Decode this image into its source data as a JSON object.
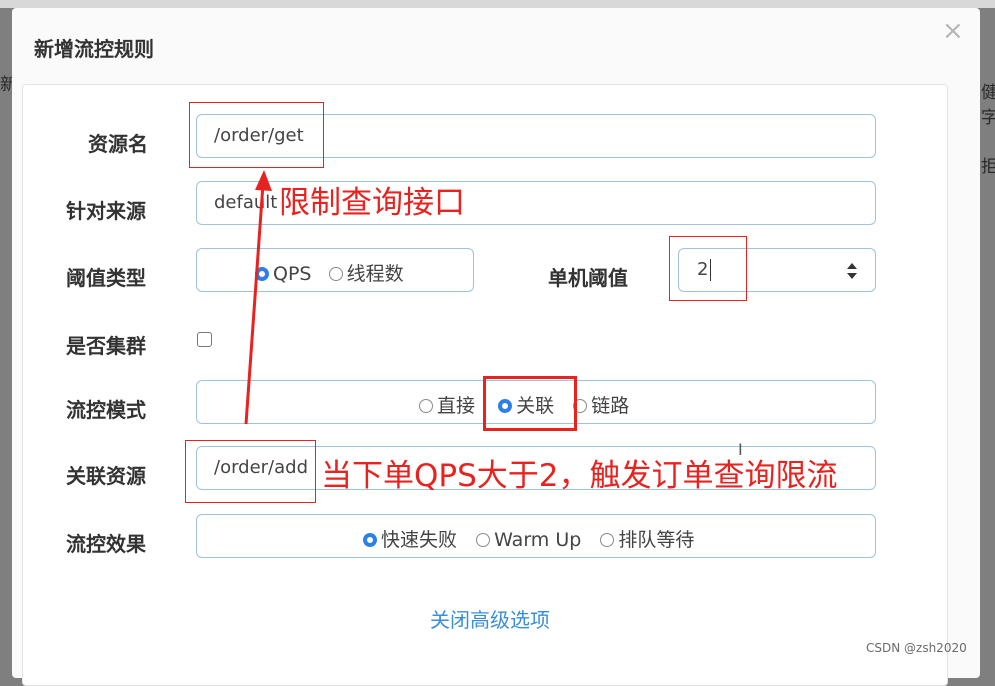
{
  "modal": {
    "title": "新增流控规则",
    "close_symbol": "×"
  },
  "background": {
    "glyph_1": "新",
    "glyph_2": "健字",
    "glyph_3": "拒"
  },
  "form": {
    "resource_name": {
      "label": "资源名",
      "value": "/order/get"
    },
    "limit_app": {
      "label": "针对来源",
      "value": "default"
    },
    "threshold_type": {
      "label": "阈值类型",
      "options": [
        {
          "label": "QPS",
          "selected": true
        },
        {
          "label": "线程数",
          "selected": false
        }
      ]
    },
    "single_threshold": {
      "label": "单机阈值",
      "value": "2"
    },
    "cluster": {
      "label": "是否集群",
      "checked": false
    },
    "flow_mode": {
      "label": "流控模式",
      "options": [
        {
          "label": "直接",
          "selected": false
        },
        {
          "label": "关联",
          "selected": true
        },
        {
          "label": "链路",
          "selected": false
        }
      ]
    },
    "ref_resource": {
      "label": "关联资源",
      "value": "/order/add"
    },
    "control_effect": {
      "label": "流控效果",
      "options": [
        {
          "label": "快速失败",
          "selected": true
        },
        {
          "label": "Warm Up",
          "selected": false
        },
        {
          "label": "排队等待",
          "selected": false
        }
      ]
    },
    "advanced_link": "关闭高级选项"
  },
  "annotations": {
    "note_limit_query": "限制查询接口",
    "note_trigger": "当下单QPS大于2，触发订单查询限流",
    "color": "#e8231f"
  },
  "watermark": "CSDN @zsh2020",
  "colors": {
    "accent": "#2f7fe8",
    "link": "#3b8fd6",
    "field_border": "#9fc3de"
  }
}
